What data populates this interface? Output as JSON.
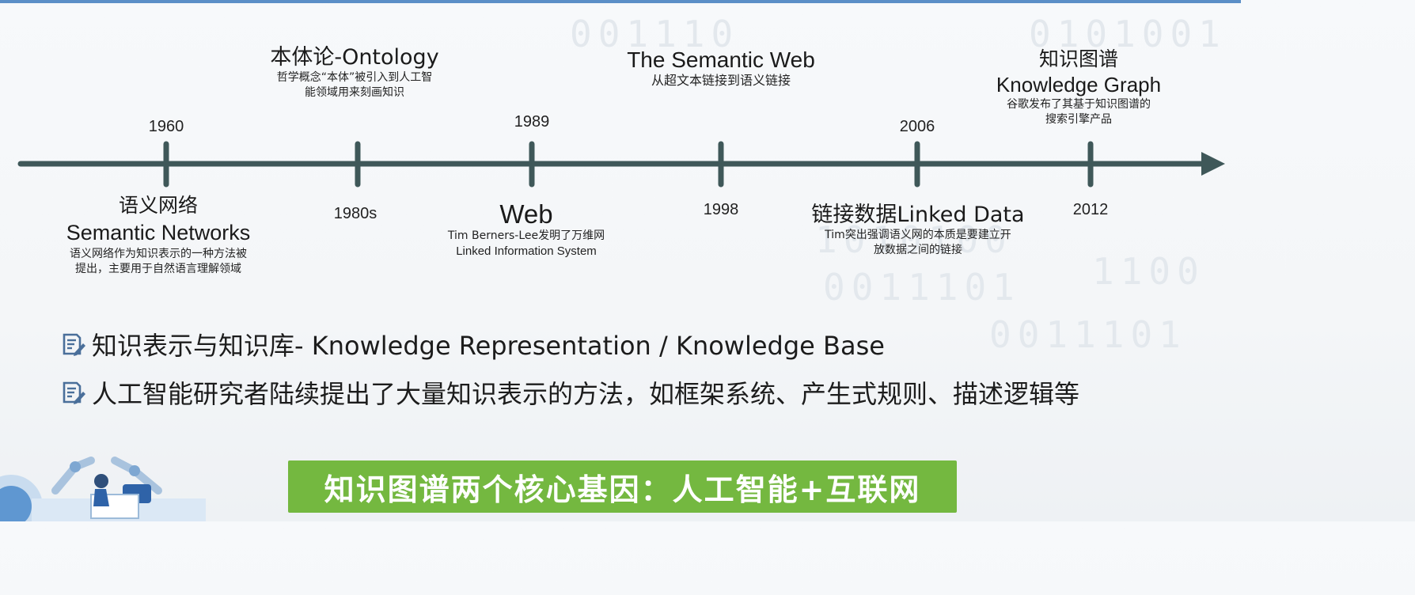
{
  "timeline": {
    "above": [
      {
        "title": "本体论-Ontology",
        "desc": [
          "哲学概念“本体”被引入到人工智",
          "能领域用来刻画知识"
        ]
      },
      {
        "title": "The Semantic Web",
        "desc": [
          "从超文本链接到语义链接"
        ]
      },
      {
        "title_cn": "知识图谱",
        "title_en": "Knowledge Graph",
        "desc": [
          "谷歌发布了其基于知识图谱的",
          "搜索引擎产品"
        ]
      }
    ],
    "years_above": [
      "1960",
      "1989",
      "2006"
    ],
    "years_below": [
      "1980s",
      "1998",
      "2012"
    ],
    "below": [
      {
        "title_cn": "语义网络",
        "title_en": "Semantic Networks",
        "desc": [
          "语义网络作为知识表示的一种方法被",
          "提出，主要用于自然语言理解领域"
        ]
      },
      {
        "title": "Web",
        "desc": [
          "Tim Berners-Lee发明了万维网",
          "Linked Information System"
        ]
      },
      {
        "title": "链接数据Linked Data",
        "desc": [
          "Tim突出强调语义网的本质是要建立开",
          "放数据之间的链接"
        ]
      }
    ]
  },
  "bullets": [
    {
      "icon": "document-edit-icon",
      "text": "知识表示与知识库- Knowledge Representation / Knowledge Base"
    },
    {
      "icon": "document-edit-icon",
      "text": "人工智能研究者陆续提出了大量知识表示的方法，如框架系统、产生式规则、描述逻辑等"
    }
  ],
  "banner": "知识图谱两个核心基因：人工智能+互联网",
  "watermark": [
    "001110",
    "1010100",
    "0011101",
    "0101001",
    "1100",
    "0011101"
  ],
  "colors": {
    "timeline": "#3f5859",
    "banner": "#74b840",
    "accent_top": "#5b8fc7",
    "text": "#1e1e1e"
  }
}
